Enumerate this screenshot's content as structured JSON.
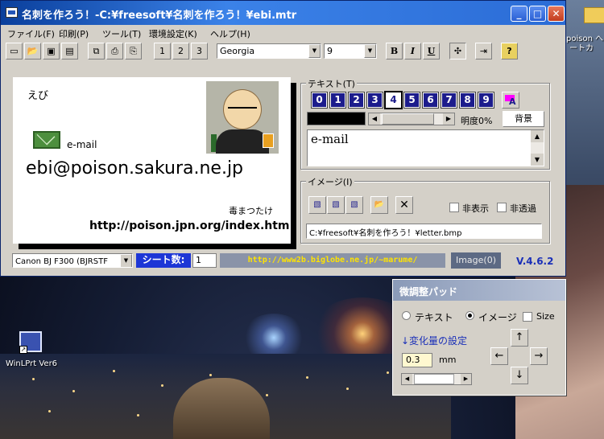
{
  "window": {
    "title": "名刺を作ろう！-C:¥freesoft¥名刺を作ろう！¥ebi.mtr",
    "minimize": "_",
    "maximize": "□",
    "close": "✕"
  },
  "menu": [
    "ファイル(F)",
    "印刷(P)",
    "ツール(T)",
    "環境設定(K)",
    "ヘルプ(H)"
  ],
  "toolbar": {
    "font": "Georgia",
    "size": "9",
    "bold": "B",
    "italic": "I",
    "underline": "U",
    "move": "✣",
    "exit": "⇥",
    "help": "?"
  },
  "card": {
    "name": "えび",
    "email_label": "e-mail",
    "email": "ebi@poison.sakura.ne.jp",
    "nickname": "毒まつたけ",
    "url": "http://poison.jpn.org/index.htm"
  },
  "text_group": {
    "label": "テキスト(T)",
    "numbers": [
      "0",
      "1",
      "2",
      "3",
      "4",
      "5",
      "6",
      "7",
      "8",
      "9"
    ],
    "brightness": "明度0%",
    "bg_button": "背景",
    "content": "e-mail"
  },
  "image_group": {
    "label": "イメージ(I)",
    "hide_label": "非表示",
    "opaque_label": "非透過",
    "path": "C:¥freesoft¥名刺を作ろう！¥letter.bmp"
  },
  "status": {
    "printer": "Canon BJ F300 (BJRSTF",
    "sheet_label": "シート数:",
    "sheet_value": "1",
    "url": "http://www2b.biglobe.ne.jp/~marume/",
    "image_button": "Image(0)",
    "version": "V.4.6.2"
  },
  "pad": {
    "title": "微調整パッド",
    "radio_text": "テキスト",
    "radio_image": "イメージ",
    "size_label": "Size",
    "change_label": "↓変化量の設定",
    "value": "0.3",
    "unit": "mm",
    "up": "↑",
    "down": "↓",
    "left": "←",
    "right": "→"
  },
  "desktop": {
    "icon1_label": "WinLPrt Ver6",
    "icon2_label": "poison へ",
    "icon2_sub": "ートカ"
  }
}
